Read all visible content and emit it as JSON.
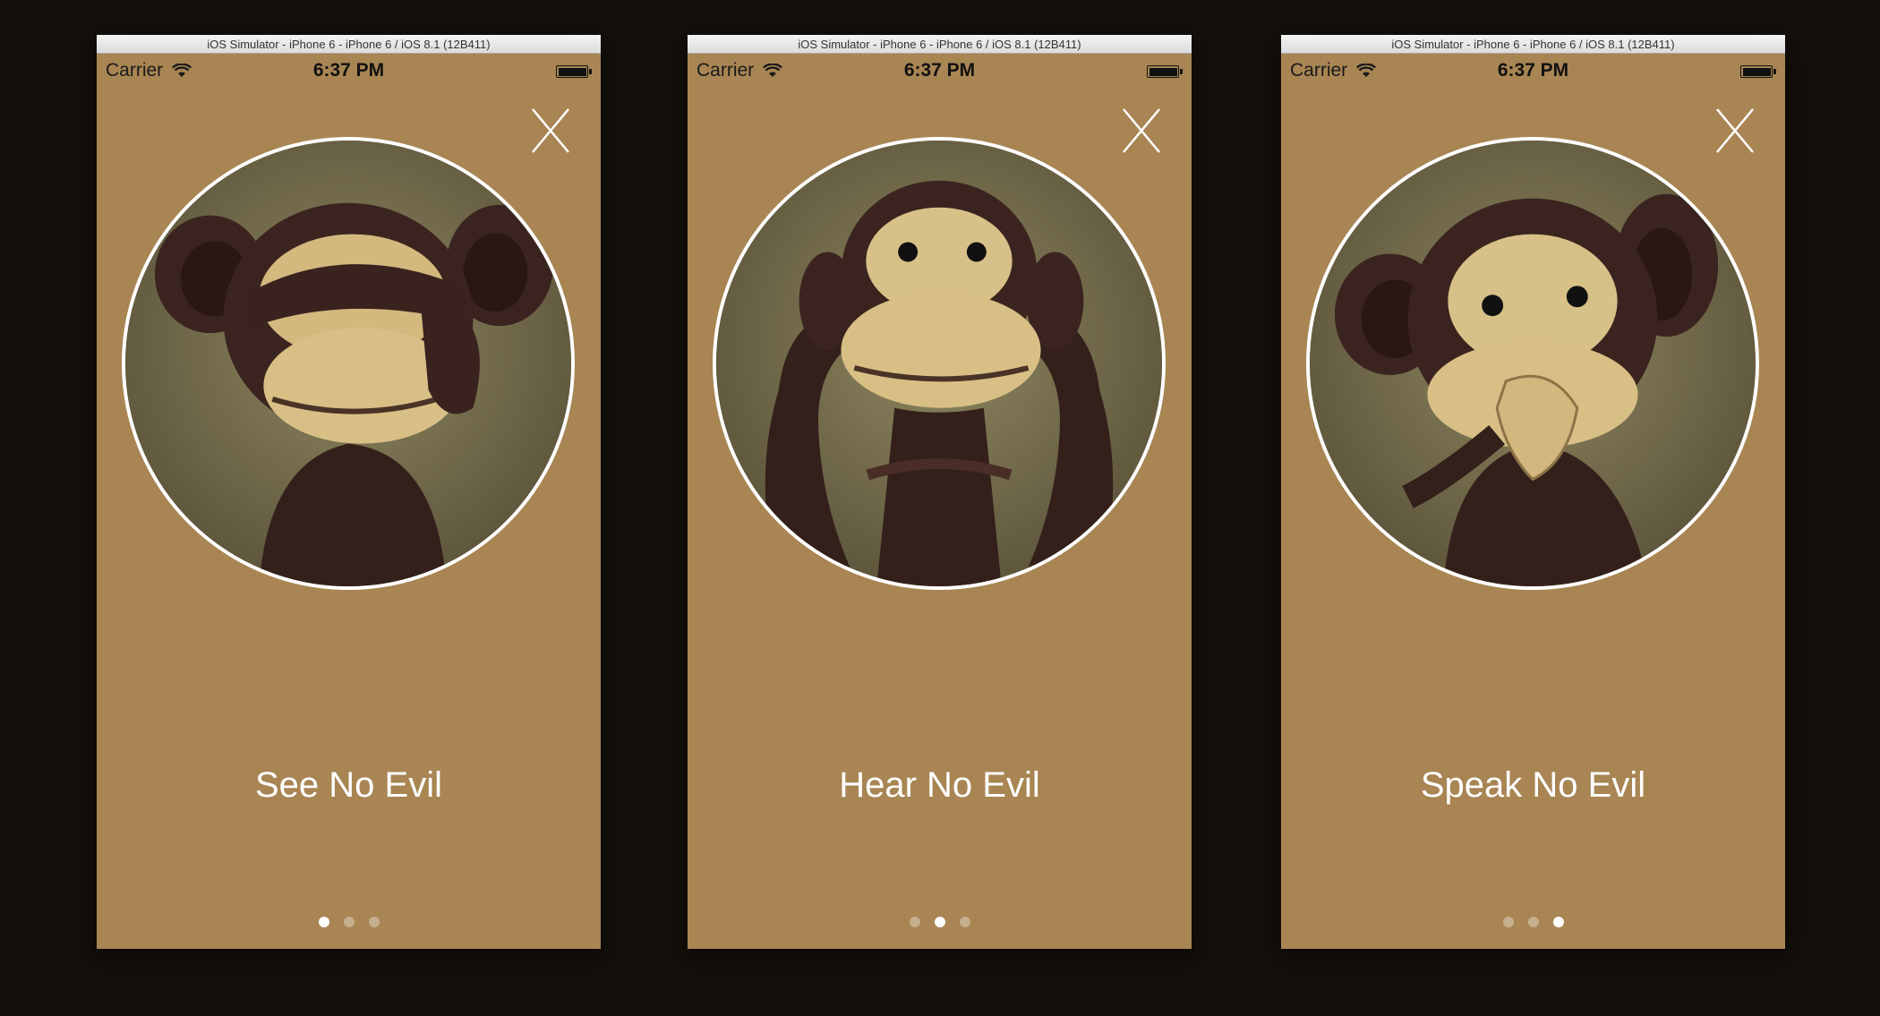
{
  "colors": {
    "background": "#14100b",
    "screen": "#a88553",
    "dot_active": "#ffffff",
    "dot_inactive": "rgba(255,255,255,0.35)"
  },
  "screens": [
    {
      "window_title": "iOS Simulator - iPhone 6 - iPhone 6 / iOS 8.1 (12B411)",
      "carrier": "Carrier",
      "time": "6:37 PM",
      "caption": "See No Evil",
      "image_icon": "monkey-covering-eyes",
      "active_page": 1
    },
    {
      "window_title": "iOS Simulator - iPhone 6 - iPhone 6 / iOS 8.1 (12B411)",
      "carrier": "Carrier",
      "time": "6:37 PM",
      "caption": "Hear No Evil",
      "image_icon": "monkey-covering-ears",
      "active_page": 2
    },
    {
      "window_title": "iOS Simulator - iPhone 6 - iPhone 6 / iOS 8.1 (12B411)",
      "carrier": "Carrier",
      "time": "6:37 PM",
      "caption": "Speak No Evil",
      "image_icon": "monkey-covering-mouth",
      "active_page": 3
    }
  ],
  "page_count": 3
}
